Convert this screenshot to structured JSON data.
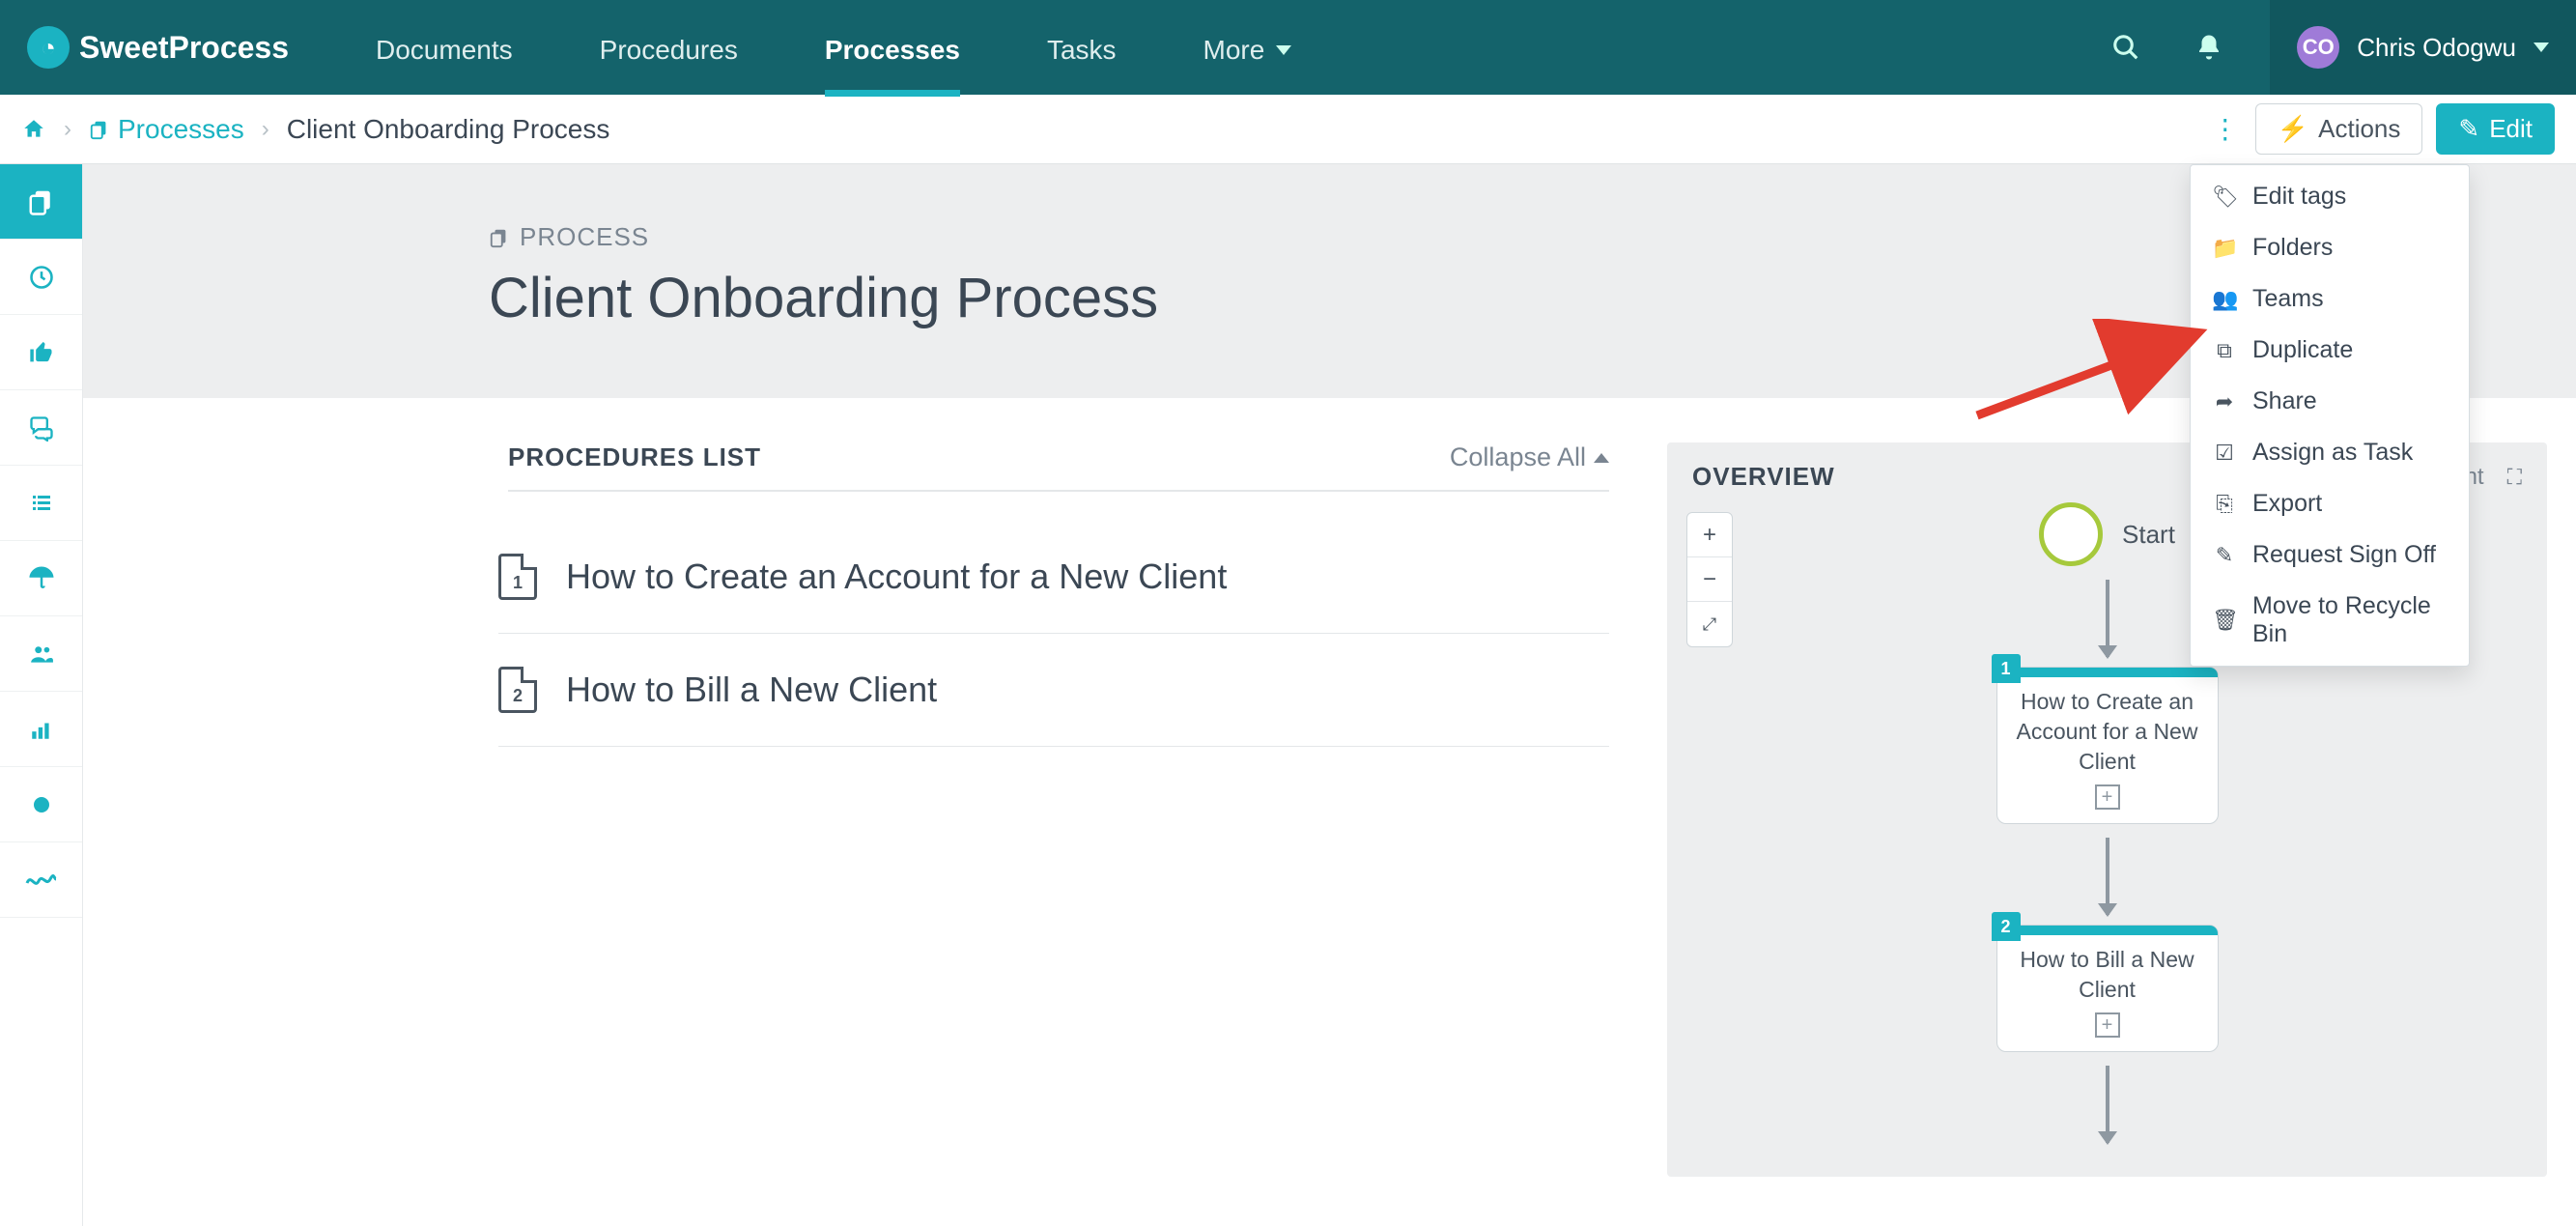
{
  "brand": {
    "name": "SweetProcess"
  },
  "nav": {
    "items": [
      {
        "label": "Documents"
      },
      {
        "label": "Procedures"
      },
      {
        "label": "Processes",
        "active": true
      },
      {
        "label": "Tasks"
      },
      {
        "label": "More"
      }
    ]
  },
  "user": {
    "initials": "CO",
    "name": "Chris Odogwu"
  },
  "breadcrumb": {
    "link_label": "Processes",
    "current": "Client Onboarding Process",
    "actions_label": "Actions",
    "edit_label": "Edit"
  },
  "page": {
    "eyebrow": "PROCESS",
    "title": "Client Onboarding Process",
    "start_label": "Sta"
  },
  "procedures": {
    "heading": "PROCEDURES LIST",
    "collapse_label": "Collapse All",
    "items": [
      {
        "n": "1",
        "title": "How to Create an Account for a New Client"
      },
      {
        "n": "2",
        "title": "How to Bill a New Client"
      }
    ]
  },
  "overview": {
    "heading": "OVERVIEW",
    "print_label": "print",
    "start_label": "Start",
    "cards": [
      {
        "n": "1",
        "text": "How to Create an Account for a New Client"
      },
      {
        "n": "2",
        "text": "How to Bill a New Client"
      }
    ]
  },
  "dropdown": {
    "items": [
      {
        "icon": "tag-icon",
        "glyph": "🏷",
        "label": "Edit tags"
      },
      {
        "icon": "folder-icon",
        "glyph": "📁",
        "label": "Folders"
      },
      {
        "icon": "teams-icon",
        "glyph": "👥",
        "label": "Teams"
      },
      {
        "icon": "duplicate-icon",
        "glyph": "⧉",
        "label": "Duplicate"
      },
      {
        "icon": "share-icon",
        "glyph": "➦",
        "label": "Share"
      },
      {
        "icon": "assign-task-icon",
        "glyph": "☑",
        "label": "Assign as Task"
      },
      {
        "icon": "export-icon",
        "glyph": "⎘",
        "label": "Export"
      },
      {
        "icon": "signoff-icon",
        "glyph": "✎",
        "label": "Request Sign Off"
      },
      {
        "icon": "recycle-icon",
        "glyph": "🗑",
        "label": "Move to Recycle Bin"
      }
    ]
  },
  "colors": {
    "teal": "#14636b",
    "cyan": "#1bb3c2",
    "arrow_red": "#e23b2e"
  }
}
